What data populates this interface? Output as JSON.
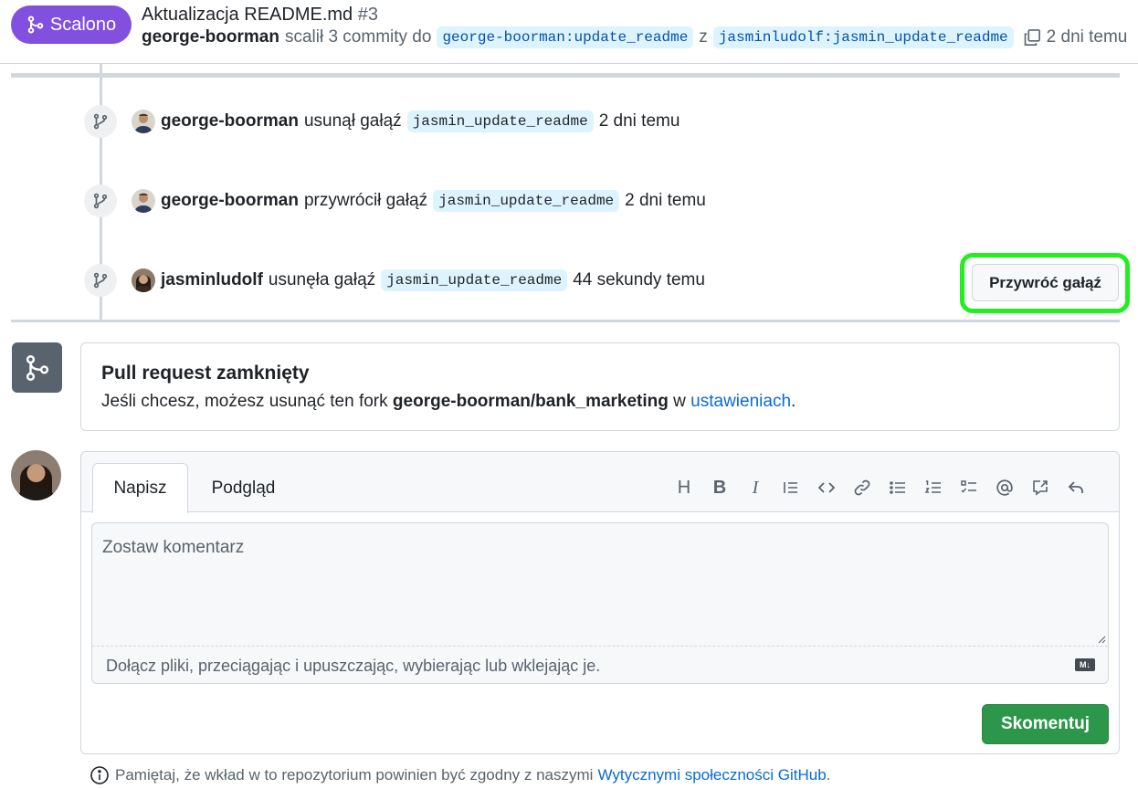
{
  "header": {
    "state_label": "Scalono",
    "title": "Aktualizacja README.md",
    "number": "#3",
    "author": "george-boorman",
    "merge_text": "scalił 3 commity do",
    "base_branch": "george-boorman:update_readme",
    "connector": "z",
    "head_branch": "jasminludolf:jasmin_update_readme",
    "time": "2 dni temu"
  },
  "timeline": [
    {
      "user": "george-boorman",
      "action": "usunął gałąź",
      "branch": "jasmin_update_readme",
      "time": "2 dni temu"
    },
    {
      "user": "george-boorman",
      "action": "przywrócił gałąź",
      "branch": "jasmin_update_readme",
      "time": "2 dni temu"
    },
    {
      "user": "jasminludolf",
      "action": "usunęła gałąź",
      "branch": "jasmin_update_readme",
      "time": "44 sekundy temu"
    }
  ],
  "restore_button": "Przywróć gałąź",
  "closed": {
    "title": "Pull request zamknięty",
    "desc_prefix": "Jeśli chcesz, możesz usunąć ten fork",
    "repo": "george-boorman/bank_marketing",
    "desc_mid": "w",
    "link": "ustawieniach",
    "desc_suffix": "."
  },
  "composer": {
    "tab_write": "Napisz",
    "tab_preview": "Podgląd",
    "placeholder": "Zostaw komentarz",
    "attach_text": "Dołącz pliki, przeciągając i upuszczając, wybierając lub wklejając je.",
    "md_badge": "M↓",
    "submit": "Skomentuj",
    "toolbar": {
      "heading": "H",
      "bold": "B",
      "italic": "I"
    }
  },
  "footer": {
    "prefix": "Pamiętaj, że wkład w to repozytorium powinien być zgodny z naszymi",
    "link": "Wytycznymi społeczności GitHub",
    "suffix": "."
  },
  "colors": {
    "merged": "#8250df",
    "highlight": "#22ee22",
    "primary": "#2c974b",
    "link": "#0969da"
  }
}
